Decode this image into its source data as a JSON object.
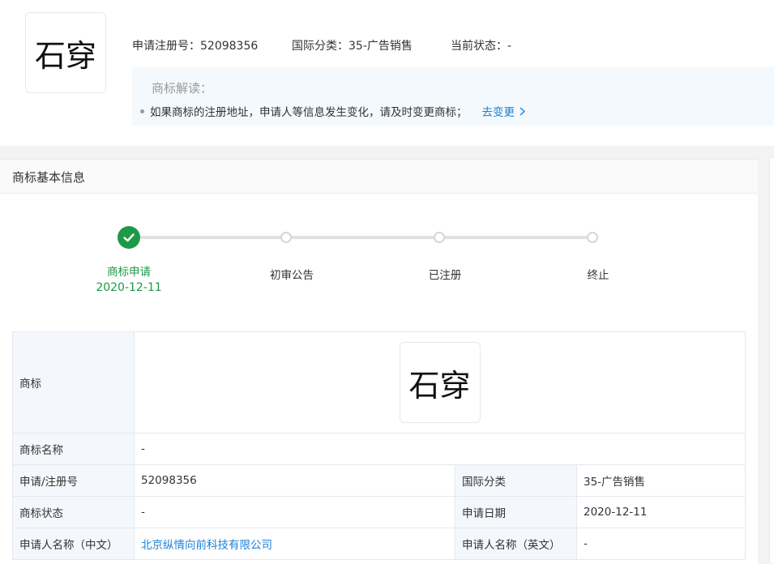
{
  "trademark": {
    "logo_text": "石穿",
    "reg_no_label": "申请注册号：",
    "reg_no": "52098356",
    "intl_class_label": "国际分类：",
    "intl_class": "35-广告销售",
    "status_label": "当前状态：",
    "status": "-"
  },
  "notice": {
    "title": "商标解读：",
    "line": "如果商标的注册地址，申请人等信息发生变化，请及时变更商标；",
    "link_label": "去变更"
  },
  "section": {
    "title": "商标基本信息"
  },
  "steps": [
    {
      "label": "商标申请",
      "date": "2020-12-11",
      "done": true
    },
    {
      "label": "初审公告",
      "date": "",
      "done": false
    },
    {
      "label": "已注册",
      "date": "",
      "done": false
    },
    {
      "label": "终止",
      "date": "",
      "done": false
    }
  ],
  "table": {
    "rows": [
      {
        "label": "商标",
        "logo_text": "石穿"
      },
      {
        "label": "商标名称",
        "value": "-"
      },
      {
        "label": "申请/注册号",
        "value": "52098356",
        "label2": "国际分类",
        "value2": "35-广告销售"
      },
      {
        "label": "商标状态",
        "value": "-",
        "label2": "申请日期",
        "value2": "2020-12-11"
      },
      {
        "label": "申请人名称（中文）",
        "value": "北京纵情向前科技有限公司",
        "label2": "申请人名称（英文）",
        "value2": "-"
      }
    ]
  },
  "colors": {
    "accent_green": "#1d9a47",
    "link_blue": "#1c7fd8",
    "notice_bg": "#f4f9fd"
  }
}
